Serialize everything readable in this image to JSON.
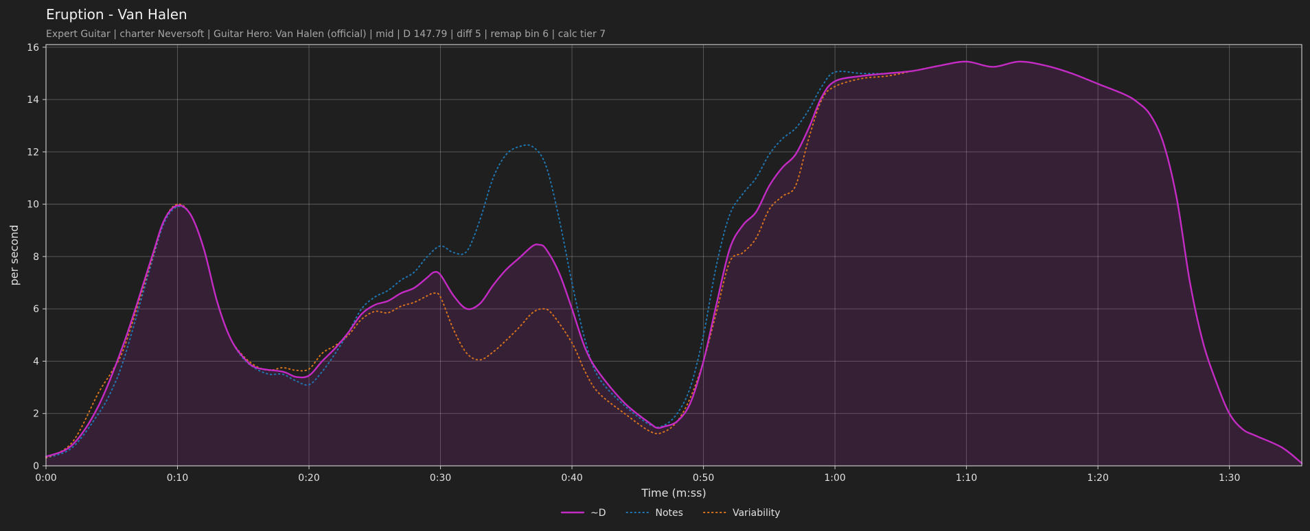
{
  "chart_data": {
    "type": "line",
    "title": "Eruption - Van Halen",
    "subtitle": "Expert Guitar  |  charter Neversoft  |  Guitar Hero: Van Halen (official)  |  mid  |  D 147.79  |  diff 5  |  remap bin 6  |  calc tier 7",
    "xlabel": "Time (m:ss)",
    "ylabel": "per second",
    "x_unit": "seconds",
    "xlim": [
      0,
      95.5
    ],
    "ylim": [
      0,
      16.1
    ],
    "x_ticks": [
      {
        "value": 0,
        "label": "0:00"
      },
      {
        "value": 10,
        "label": "0:10"
      },
      {
        "value": 20,
        "label": "0:20"
      },
      {
        "value": 30,
        "label": "0:30"
      },
      {
        "value": 40,
        "label": "0:40"
      },
      {
        "value": 50,
        "label": "0:50"
      },
      {
        "value": 60,
        "label": "1:00"
      },
      {
        "value": 70,
        "label": "1:10"
      },
      {
        "value": 80,
        "label": "1:20"
      },
      {
        "value": 90,
        "label": "1:30"
      }
    ],
    "y_ticks": [
      0,
      2,
      4,
      6,
      8,
      10,
      12,
      14,
      16
    ],
    "grid": true,
    "legend_position": "bottom-center",
    "series": [
      {
        "name": "~D",
        "style": "solid",
        "color": "#c42bc4",
        "fill": true,
        "points": [
          [
            0,
            0.35
          ],
          [
            2,
            0.8
          ],
          [
            4,
            2.3
          ],
          [
            6,
            4.8
          ],
          [
            8,
            7.9
          ],
          [
            9,
            9.4
          ],
          [
            10,
            9.95
          ],
          [
            11,
            9.6
          ],
          [
            12,
            8.3
          ],
          [
            13,
            6.3
          ],
          [
            14,
            4.9
          ],
          [
            15,
            4.15
          ],
          [
            16,
            3.75
          ],
          [
            18,
            3.6
          ],
          [
            19,
            3.4
          ],
          [
            20,
            3.45
          ],
          [
            21,
            4.0
          ],
          [
            22,
            4.5
          ],
          [
            23,
            5.1
          ],
          [
            24,
            5.8
          ],
          [
            25,
            6.15
          ],
          [
            26,
            6.3
          ],
          [
            27,
            6.6
          ],
          [
            28,
            6.8
          ],
          [
            29,
            7.2
          ],
          [
            29.5,
            7.4
          ],
          [
            30,
            7.3
          ],
          [
            31,
            6.5
          ],
          [
            32,
            6.0
          ],
          [
            33,
            6.2
          ],
          [
            34,
            6.9
          ],
          [
            35,
            7.5
          ],
          [
            36,
            7.95
          ],
          [
            37,
            8.4
          ],
          [
            37.5,
            8.45
          ],
          [
            38,
            8.3
          ],
          [
            39,
            7.4
          ],
          [
            40,
            6.0
          ],
          [
            41,
            4.5
          ],
          [
            42,
            3.6
          ],
          [
            44,
            2.4
          ],
          [
            46,
            1.6
          ],
          [
            46.5,
            1.45
          ],
          [
            47,
            1.5
          ],
          [
            48,
            1.7
          ],
          [
            49,
            2.4
          ],
          [
            50,
            4.0
          ],
          [
            51,
            6.2
          ],
          [
            52,
            8.3
          ],
          [
            53,
            9.2
          ],
          [
            54,
            9.7
          ],
          [
            55,
            10.7
          ],
          [
            56,
            11.4
          ],
          [
            57,
            11.9
          ],
          [
            58,
            12.9
          ],
          [
            59,
            14.1
          ],
          [
            60,
            14.7
          ],
          [
            62,
            14.9
          ],
          [
            64,
            15.0
          ],
          [
            66,
            15.1
          ],
          [
            68,
            15.3
          ],
          [
            70,
            15.45
          ],
          [
            72,
            15.25
          ],
          [
            74,
            15.45
          ],
          [
            76,
            15.3
          ],
          [
            78,
            15.0
          ],
          [
            80,
            14.6
          ],
          [
            82,
            14.2
          ],
          [
            83,
            13.9
          ],
          [
            84,
            13.4
          ],
          [
            85,
            12.3
          ],
          [
            86,
            10.2
          ],
          [
            87,
            7.0
          ],
          [
            88,
            4.7
          ],
          [
            89,
            3.2
          ],
          [
            90,
            2.0
          ],
          [
            91,
            1.4
          ],
          [
            92,
            1.15
          ],
          [
            94,
            0.7
          ],
          [
            95.5,
            0.1
          ]
        ]
      },
      {
        "name": "Notes",
        "style": "dotted",
        "color": "#1f77b4",
        "fill": false,
        "points": [
          [
            0,
            0.3
          ],
          [
            2,
            0.7
          ],
          [
            4,
            2.0
          ],
          [
            5,
            2.9
          ],
          [
            6,
            4.2
          ],
          [
            8,
            7.7
          ],
          [
            9,
            9.3
          ],
          [
            10,
            9.9
          ],
          [
            11,
            9.6
          ],
          [
            12,
            8.3
          ],
          [
            13,
            6.3
          ],
          [
            14,
            4.9
          ],
          [
            15,
            4.1
          ],
          [
            16,
            3.7
          ],
          [
            17,
            3.5
          ],
          [
            18,
            3.5
          ],
          [
            19,
            3.25
          ],
          [
            20,
            3.1
          ],
          [
            21,
            3.6
          ],
          [
            22,
            4.3
          ],
          [
            23,
            5.1
          ],
          [
            24,
            6.0
          ],
          [
            25,
            6.45
          ],
          [
            26,
            6.7
          ],
          [
            27,
            7.1
          ],
          [
            28,
            7.4
          ],
          [
            29,
            8.0
          ],
          [
            30,
            8.4
          ],
          [
            31,
            8.15
          ],
          [
            32,
            8.2
          ],
          [
            33,
            9.4
          ],
          [
            34,
            11.0
          ],
          [
            35,
            11.9
          ],
          [
            36,
            12.2
          ],
          [
            37,
            12.2
          ],
          [
            38,
            11.5
          ],
          [
            39,
            9.5
          ],
          [
            40,
            7.0
          ],
          [
            41,
            4.8
          ],
          [
            42,
            3.4
          ],
          [
            44,
            2.3
          ],
          [
            46,
            1.55
          ],
          [
            47,
            1.55
          ],
          [
            48,
            2.0
          ],
          [
            49,
            3.0
          ],
          [
            50,
            5.0
          ],
          [
            51,
            7.7
          ],
          [
            52,
            9.6
          ],
          [
            53,
            10.4
          ],
          [
            54,
            11.0
          ],
          [
            55,
            11.9
          ],
          [
            56,
            12.5
          ],
          [
            57,
            12.9
          ],
          [
            58,
            13.6
          ],
          [
            59,
            14.5
          ],
          [
            60,
            15.05
          ],
          [
            62,
            15.0
          ],
          [
            64,
            15.0
          ],
          [
            66,
            15.1
          ],
          [
            68,
            15.3
          ],
          [
            70,
            15.45
          ],
          [
            72,
            15.25
          ],
          [
            74,
            15.45
          ],
          [
            76,
            15.3
          ],
          [
            78,
            15.0
          ],
          [
            80,
            14.6
          ],
          [
            82,
            14.2
          ],
          [
            83,
            13.9
          ],
          [
            84,
            13.4
          ],
          [
            85,
            12.3
          ],
          [
            86,
            10.2
          ],
          [
            87,
            7.0
          ],
          [
            88,
            4.7
          ],
          [
            89,
            3.2
          ],
          [
            90,
            2.0
          ],
          [
            91,
            1.4
          ],
          [
            92,
            1.15
          ],
          [
            94,
            0.7
          ],
          [
            95.5,
            0.1
          ]
        ]
      },
      {
        "name": "Variability",
        "style": "dotted",
        "color": "#d7731d",
        "fill": false,
        "points": [
          [
            0,
            0.3
          ],
          [
            2,
            0.9
          ],
          [
            4,
            2.8
          ],
          [
            5,
            3.6
          ],
          [
            6,
            4.6
          ],
          [
            8,
            7.8
          ],
          [
            9,
            9.4
          ],
          [
            10,
            10.0
          ],
          [
            11,
            9.6
          ],
          [
            12,
            8.3
          ],
          [
            13,
            6.3
          ],
          [
            14,
            4.9
          ],
          [
            15,
            4.2
          ],
          [
            16,
            3.8
          ],
          [
            17,
            3.65
          ],
          [
            18,
            3.75
          ],
          [
            19,
            3.65
          ],
          [
            20,
            3.7
          ],
          [
            21,
            4.3
          ],
          [
            22,
            4.6
          ],
          [
            23,
            5.0
          ],
          [
            24,
            5.6
          ],
          [
            25,
            5.9
          ],
          [
            26,
            5.85
          ],
          [
            27,
            6.1
          ],
          [
            28,
            6.25
          ],
          [
            29,
            6.5
          ],
          [
            29.5,
            6.6
          ],
          [
            30,
            6.45
          ],
          [
            31,
            5.2
          ],
          [
            32,
            4.3
          ],
          [
            33,
            4.05
          ],
          [
            34,
            4.35
          ],
          [
            35,
            4.8
          ],
          [
            36,
            5.3
          ],
          [
            37,
            5.85
          ],
          [
            37.8,
            6.0
          ],
          [
            38.5,
            5.8
          ],
          [
            40,
            4.7
          ],
          [
            41,
            3.6
          ],
          [
            42,
            2.8
          ],
          [
            44,
            2.0
          ],
          [
            46,
            1.3
          ],
          [
            47,
            1.3
          ],
          [
            48,
            1.7
          ],
          [
            49,
            2.6
          ],
          [
            50,
            4.0
          ],
          [
            51,
            5.9
          ],
          [
            52,
            7.8
          ],
          [
            53,
            8.15
          ],
          [
            54,
            8.7
          ],
          [
            55,
            9.8
          ],
          [
            56,
            10.3
          ],
          [
            57,
            10.7
          ],
          [
            58,
            12.5
          ],
          [
            59,
            14.0
          ],
          [
            60,
            14.5
          ],
          [
            62,
            14.8
          ],
          [
            64,
            14.9
          ],
          [
            66,
            15.1
          ],
          [
            68,
            15.3
          ],
          [
            70,
            15.45
          ],
          [
            72,
            15.25
          ],
          [
            74,
            15.45
          ],
          [
            76,
            15.3
          ],
          [
            78,
            15.0
          ],
          [
            80,
            14.6
          ],
          [
            82,
            14.2
          ],
          [
            83,
            13.9
          ],
          [
            84,
            13.4
          ],
          [
            85,
            12.3
          ],
          [
            86,
            10.2
          ],
          [
            87,
            7.0
          ],
          [
            88,
            4.7
          ],
          [
            89,
            3.2
          ],
          [
            90,
            2.0
          ],
          [
            91,
            1.4
          ],
          [
            92,
            1.15
          ],
          [
            94,
            0.7
          ],
          [
            95.5,
            0.1
          ]
        ]
      }
    ]
  }
}
